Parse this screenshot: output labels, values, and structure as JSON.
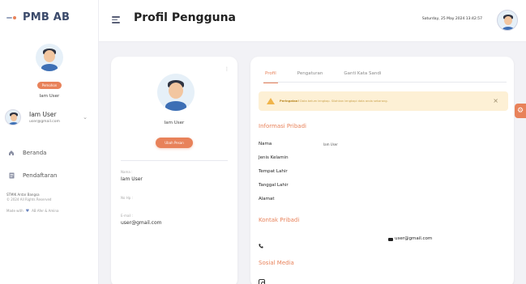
{
  "app": {
    "brand": "PMB AB"
  },
  "sidebar": {
    "profile": {
      "role_badge": "Pemohon",
      "name": "Iam User"
    },
    "user_card": {
      "name": "Iam User",
      "email": "user@gmail.com"
    },
    "nav": [
      {
        "label": "Beranda",
        "icon": "home-icon"
      },
      {
        "label": "Pendaftaran",
        "icon": "document-icon"
      }
    ],
    "footer": {
      "institution": "STMIK Antar Bangsa",
      "copyright": "© 2024 All Rights Reserved",
      "made_with": "Made with",
      "made_by": "AB Afer & Amina"
    }
  },
  "header": {
    "title": "Profil Pengguna",
    "datetime": "Saturday, 25 May 2024 13:42:57"
  },
  "profile_card": {
    "name": "Iam User",
    "edit_button": "Ubah Pesan",
    "fields": [
      {
        "label": "Nama :",
        "value": "Iam User"
      },
      {
        "label": "No Hp :",
        "value": ""
      },
      {
        "label": "E-mail :",
        "value": "user@gmail.com"
      }
    ]
  },
  "detail_card": {
    "tabs": [
      {
        "label": "Profil",
        "active": true
      },
      {
        "label": "Pengaturan",
        "active": false
      },
      {
        "label": "Ganti Kata Sandi",
        "active": false
      }
    ],
    "alert": {
      "strong": "Peringatan!",
      "text": "Data belum lengkap. Silahkan lengkapi data anda sekarang."
    },
    "personal_info": {
      "title": "Informasi Pribadi",
      "rows": [
        {
          "label": "Nama",
          "value": "Iam User"
        },
        {
          "label": "Jenis Kelamin",
          "value": ""
        },
        {
          "label": "Tempat Lahir",
          "value": ""
        },
        {
          "label": "Tanggal Lahir",
          "value": ""
        },
        {
          "label": "Alamat",
          "value": ""
        }
      ]
    },
    "contact": {
      "title": "Kontak Pribadi",
      "phone": "",
      "email": "user@gmail.com"
    },
    "social": {
      "title": "Sosial Media"
    }
  },
  "colors": {
    "accent": "#e8825a",
    "warning_bg": "#fdf0d5",
    "sidebar_bg": "#ffffff",
    "page_bg": "#f2f2f6"
  }
}
